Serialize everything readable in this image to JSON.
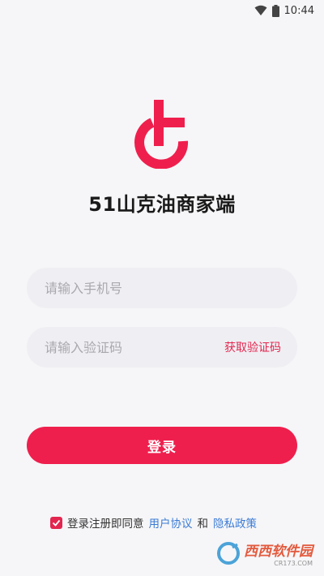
{
  "status_bar": {
    "time": "10:44",
    "wifi_icon": "wifi-icon",
    "battery_icon": "battery-icon"
  },
  "app": {
    "title": "51山克油商家端",
    "logo_icon": "brand-logo-icon",
    "brand_color": "#ef1f4d"
  },
  "form": {
    "phone_placeholder": "请输入手机号",
    "phone_value": "",
    "code_placeholder": "请输入验证码",
    "code_value": "",
    "get_code_label": "获取验证码",
    "login_label": "登录"
  },
  "agreement": {
    "checked": true,
    "prefix": "登录注册即同意",
    "user_agreement": "用户协议",
    "conjunction": "和",
    "privacy_policy": "隐私政策"
  },
  "watermark": {
    "main": "西西软件园",
    "sub": "CR173.COM"
  }
}
